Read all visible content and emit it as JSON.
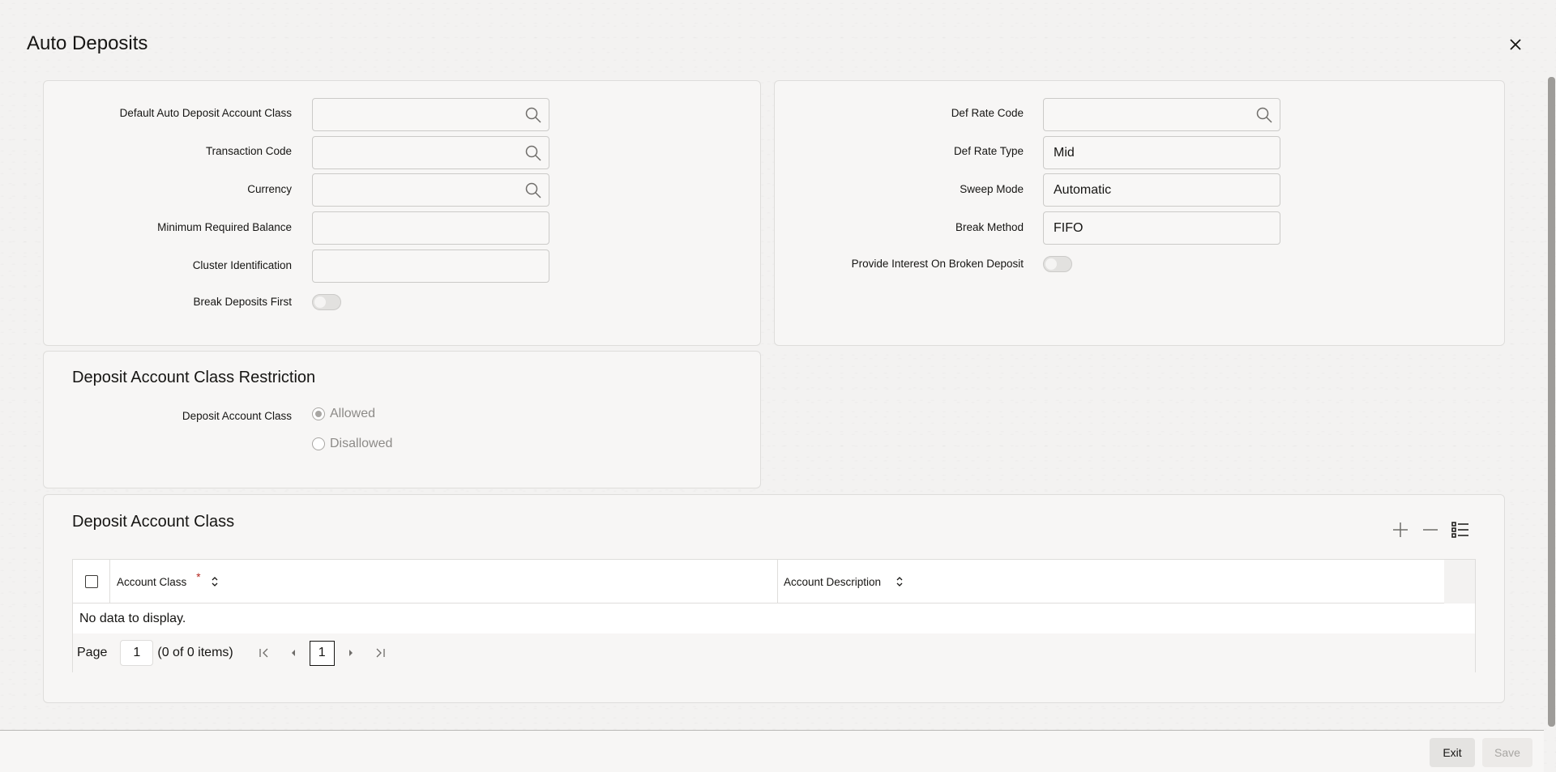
{
  "window": {
    "title": "Auto Deposits"
  },
  "left_panel": {
    "fields": [
      {
        "label": "Default Auto Deposit Account Class",
        "value": ""
      },
      {
        "label": "Transaction Code",
        "value": ""
      },
      {
        "label": "Currency",
        "value": ""
      },
      {
        "label": "Minimum Required Balance",
        "value": ""
      },
      {
        "label": "Cluster Identification",
        "value": ""
      }
    ],
    "break_deposits_first": {
      "label": "Break Deposits First",
      "checked": false
    }
  },
  "right_panel": {
    "fields": [
      {
        "label": "Def Rate Code",
        "value": ""
      },
      {
        "label": "Def Rate Type",
        "value": "Mid"
      },
      {
        "label": "Sweep Mode",
        "value": "Automatic"
      },
      {
        "label": "Break Method",
        "value": "FIFO"
      }
    ],
    "provide_interest": {
      "label": "Provide Interest On Broken Deposit",
      "checked": false
    }
  },
  "restriction": {
    "title": "Deposit Account Class Restriction",
    "label": "Deposit Account Class",
    "options": [
      {
        "label": "Allowed",
        "selected": true
      },
      {
        "label": "Disallowed",
        "selected": false
      }
    ]
  },
  "deposit_class": {
    "title": "Deposit Account Class",
    "columns": [
      {
        "label": "Account Class",
        "required_mark": "*"
      },
      {
        "label": "Account Description"
      }
    ],
    "empty_text": "No data to display.",
    "pager": {
      "page_label": "Page",
      "page_value": "1",
      "items_text": "(0 of 0 items)",
      "current_page": "1"
    }
  },
  "footer": {
    "exit_label": "Exit",
    "save_label": "Save"
  },
  "colors": {
    "required": "#b3261e",
    "panel": "#f7f6f5",
    "border": "#dedddb"
  }
}
